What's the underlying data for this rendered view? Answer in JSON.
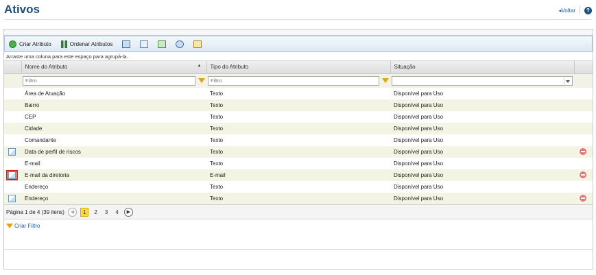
{
  "page": {
    "title": "Ativos",
    "back_label": "Voltar"
  },
  "toolbar": {
    "create_attribute": "Criar Atributo",
    "order_attributes": "Ordenar Atributos"
  },
  "grid": {
    "group_hint": "Arraste uma coluna para este espaço para agrupá-la.",
    "columns": [
      "Nome do Atributo",
      "Tipo do Atributo",
      "Situação"
    ],
    "filter_placeholder_name": "Filtro",
    "filter_placeholder_type": "Filtro",
    "rows": [
      {
        "name": "Área de Atuação",
        "type": "Texto",
        "status": "Disponível para Uso",
        "editable": false
      },
      {
        "name": "Bairro",
        "type": "Texto",
        "status": "Disponível para Uso",
        "editable": false
      },
      {
        "name": "CEP",
        "type": "Texto",
        "status": "Disponível para Uso",
        "editable": false
      },
      {
        "name": "Cidade",
        "type": "Texto",
        "status": "Disponível para Uso",
        "editable": false
      },
      {
        "name": "Comandante",
        "type": "Texto",
        "status": "Disponível para Uso",
        "editable": false
      },
      {
        "name": "Data de perfil de riscos",
        "type": "Texto",
        "status": "Disponível para Uso",
        "editable": true
      },
      {
        "name": "E-mail",
        "type": "Texto",
        "status": "Disponível para Uso",
        "editable": false
      },
      {
        "name": "E-mail da diretoria",
        "type": "E-mail",
        "status": "Disponível para Uso",
        "editable": true,
        "highlighted": true
      },
      {
        "name": "Endereço",
        "type": "Texto",
        "status": "Disponível para Uso",
        "editable": false
      },
      {
        "name": "Endereço",
        "type": "Texto",
        "status": "Disponível para Uso",
        "editable": true
      }
    ]
  },
  "pager": {
    "summary": "Página 1 de 4 (39 itens)",
    "pages": [
      "1",
      "2",
      "3",
      "4"
    ],
    "current": "1"
  },
  "footer": {
    "create_filter": "Criar Filtro"
  }
}
